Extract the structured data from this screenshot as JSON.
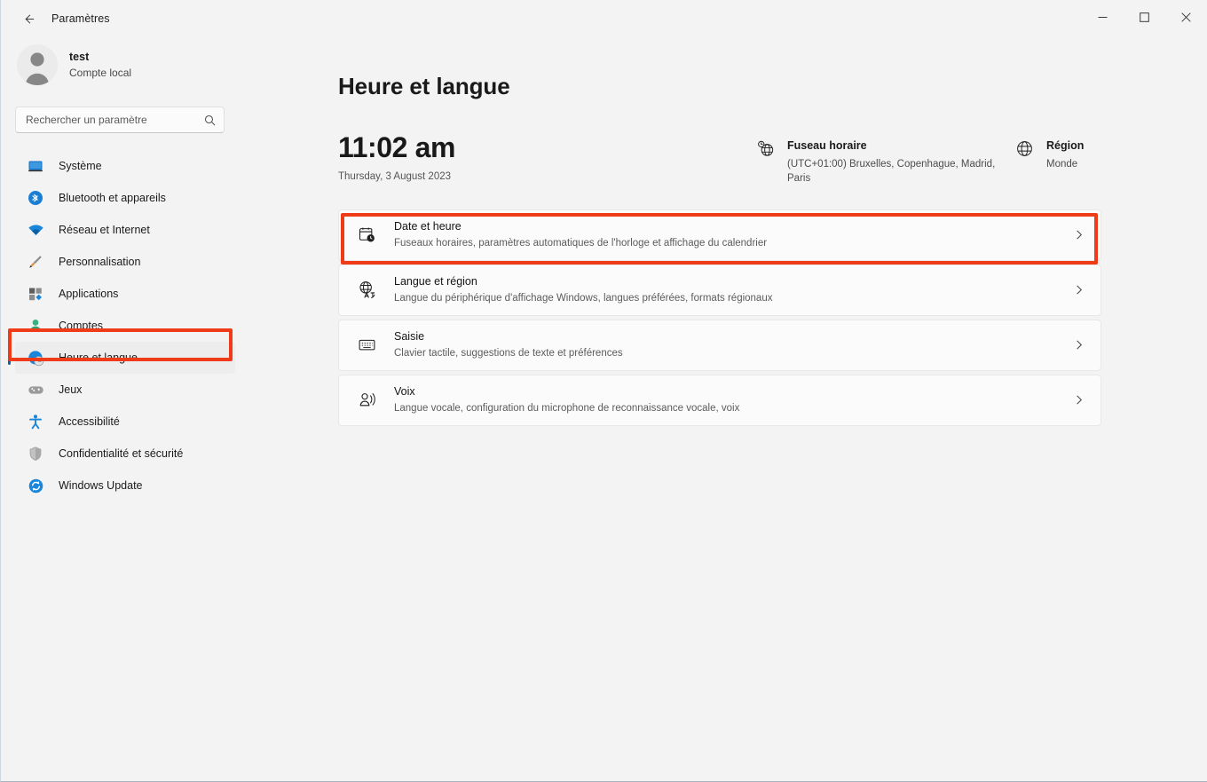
{
  "window": {
    "app_title": "Paramètres",
    "back_icon": "back-arrow-icon",
    "controls": {
      "minimize": "minimize-icon",
      "maximize": "maximize-icon",
      "close": "close-icon"
    }
  },
  "sidebar": {
    "account": {
      "name": "test",
      "type": "Compte local",
      "avatar_icon": "user-avatar-icon"
    },
    "search": {
      "placeholder": "Rechercher un paramètre",
      "value": "",
      "icon": "search-icon"
    },
    "items": [
      {
        "label": "Système",
        "icon": "monitor-icon",
        "selected": false
      },
      {
        "label": "Bluetooth et appareils",
        "icon": "bluetooth-icon",
        "selected": false
      },
      {
        "label": "Réseau et Internet",
        "icon": "wifi-icon",
        "selected": false
      },
      {
        "label": "Personnalisation",
        "icon": "brush-icon",
        "selected": false
      },
      {
        "label": "Applications",
        "icon": "apps-icon",
        "selected": false
      },
      {
        "label": "Comptes",
        "icon": "person-icon",
        "selected": false
      },
      {
        "label": "Heure et langue",
        "icon": "clock-globe-icon",
        "selected": true
      },
      {
        "label": "Jeux",
        "icon": "gamepad-icon",
        "selected": false
      },
      {
        "label": "Accessibilité",
        "icon": "accessibility-icon",
        "selected": false
      },
      {
        "label": "Confidentialité et sécurité",
        "icon": "shield-icon",
        "selected": false
      },
      {
        "label": "Windows Update",
        "icon": "update-icon",
        "selected": false
      }
    ]
  },
  "main": {
    "page_title": "Heure et langue",
    "clock": {
      "time": "11:02 am",
      "date": "Thursday, 3 August 2023"
    },
    "timezone": {
      "icon": "clock-globe-icon",
      "title": "Fuseau horaire",
      "value": "(UTC+01:00) Bruxelles, Copenhague, Madrid, Paris"
    },
    "region": {
      "icon": "globe-icon",
      "title": "Région",
      "value": "Monde"
    },
    "cards": [
      {
        "title": "Date et heure",
        "subtitle": "Fuseaux horaires, paramètres automatiques de l'horloge et affichage du calendrier",
        "icon": "calendar-clock-icon",
        "chevron": "chevron-right-icon"
      },
      {
        "title": "Langue et région",
        "subtitle": "Langue du périphérique d'affichage Windows, langues préférées, formats régionaux",
        "icon": "language-globe-icon",
        "chevron": "chevron-right-icon"
      },
      {
        "title": "Saisie",
        "subtitle": "Clavier tactile, suggestions de texte et préférences",
        "icon": "keyboard-icon",
        "chevron": "chevron-right-icon"
      },
      {
        "title": "Voix",
        "subtitle": "Langue vocale, configuration du microphone de reconnaissance vocale, voix",
        "icon": "speech-icon",
        "chevron": "chevron-right-icon"
      }
    ]
  },
  "annotations": {
    "color": "#ef3b18",
    "targets": [
      "sidebar-item-heure-et-langue",
      "settings-card-langue-et-region"
    ]
  }
}
